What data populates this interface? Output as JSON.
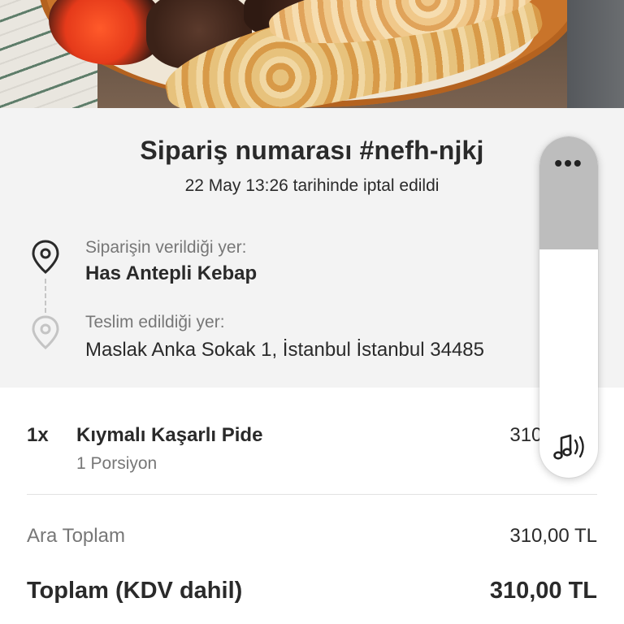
{
  "hero": {
    "image": "food-photo-kebab-platter"
  },
  "order": {
    "title": "Sipariş numarası #nefh-njkj",
    "status": "22 May 13:26 tarihinde iptal edildi",
    "pickup": {
      "label": "Siparişin verildiği yer:",
      "value": "Has Antepli Kebap",
      "icon": "location-pin-icon"
    },
    "dropoff": {
      "label": "Teslim edildiği yer:",
      "value": "Maslak Anka Sokak 1, İstanbul İstanbul 34485",
      "icon": "location-pin-icon"
    }
  },
  "items": [
    {
      "qty": "1x",
      "name": "Kıymalı Kaşarlı Pide",
      "detail": "1 Porsiyon",
      "price": "310,00 TL"
    }
  ],
  "summary": {
    "subtotal_label": "Ara Toplam",
    "subtotal_value": "310,00 TL",
    "total_label": "Toplam (KDV dahil)",
    "total_value": "310,00 TL"
  },
  "volume_panel": {
    "more_icon": "more-horizontal-icon",
    "more_label": "•••",
    "media_icon": "music-note-icon",
    "level_percent": 67
  },
  "colors": {
    "section_bg": "#f3f3f3",
    "text_primary": "#2a2a2a",
    "text_secondary": "#777777",
    "volume_fill": "#bdbdbd"
  }
}
